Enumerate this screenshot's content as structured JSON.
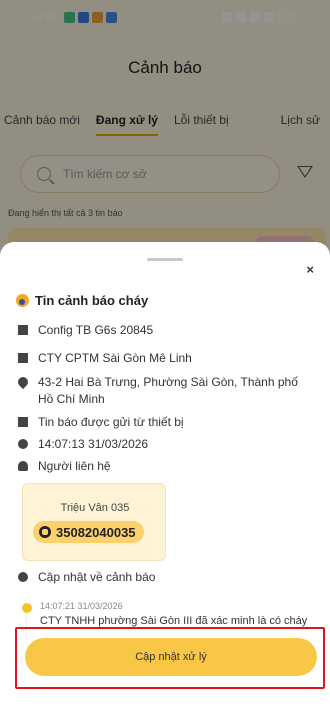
{
  "status_bar": {
    "time": "14:08",
    "battery": "100",
    "notification_icon_colors": [
      "#4cc38a",
      "#3b7de0",
      "#f3a23b",
      "#4c8be0"
    ]
  },
  "app": {
    "title": "Cảnh báo",
    "tabs": [
      {
        "label": "Cảnh báo mới",
        "active": false
      },
      {
        "label": "Đang xử lý",
        "active": true
      },
      {
        "label": "Lỗi thiết bị",
        "active": false
      },
      {
        "label": "Lịch sử",
        "active": false
      }
    ],
    "search_placeholder": "Tìm kiếm cơ sở",
    "count_text": "Đang hiển thị tất cả 3 tin báo"
  },
  "sheet": {
    "close_label": "×",
    "title": "Tin cảnh báo cháy",
    "device": "Config TB G6s 20845",
    "company": "CTY CPTM Sài Gòn Mê Linh",
    "address": "43-2 Hai Bà Trưng, Phường Sài Gòn, Thành phố Hồ Chí Minh",
    "source": "Tin báo được gửi từ thiết bị",
    "datetime": "14:07:13 31/03/2026",
    "contact_label": "Người liên hệ",
    "contact": {
      "name": "Triệu Vân 035",
      "phone": "35082040035"
    },
    "updates_label": "Cập nhật về cảnh báo",
    "updates": [
      {
        "time": "14:07:21 31/03/2026",
        "text": "CTY TNHH phường Sài Gòn III đã xác minh là có cháy"
      }
    ],
    "cta_label": "Cập nhật xử lý"
  },
  "colors": {
    "accent": "#f9c646",
    "highlight_box": "#e0141c",
    "tab_underline": "#f0a500"
  }
}
